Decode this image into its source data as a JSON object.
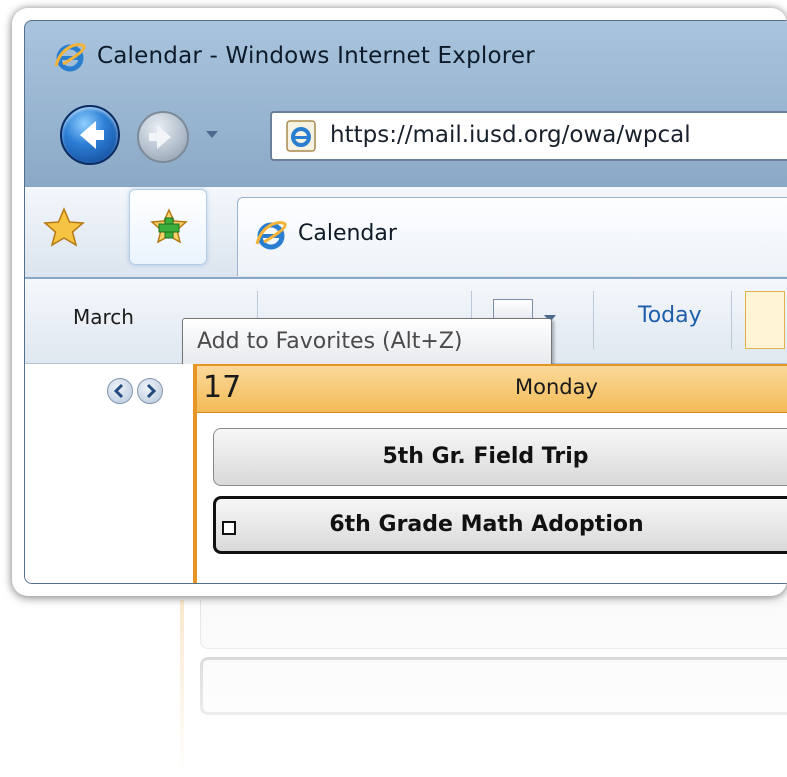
{
  "window": {
    "title": "Calendar - Windows Internet Explorer",
    "address_url": "https://mail.iusd.org/owa/wpcal"
  },
  "tabs": [
    {
      "label": "Calendar",
      "icon": "ie-icon"
    }
  ],
  "toolbar": {
    "month_label": "March",
    "today_label": "Today",
    "tooltip_text": "Add to Favorites (Alt+Z)"
  },
  "calendar": {
    "day_number": "17",
    "day_name": "Monday",
    "events": [
      {
        "title": "5th Gr. Field Trip",
        "selected": false
      },
      {
        "title": "6th Grade Math Adoption",
        "selected": true
      }
    ]
  },
  "colors": {
    "day_accent": "#e69625",
    "today_link": "#1f5ea8"
  }
}
